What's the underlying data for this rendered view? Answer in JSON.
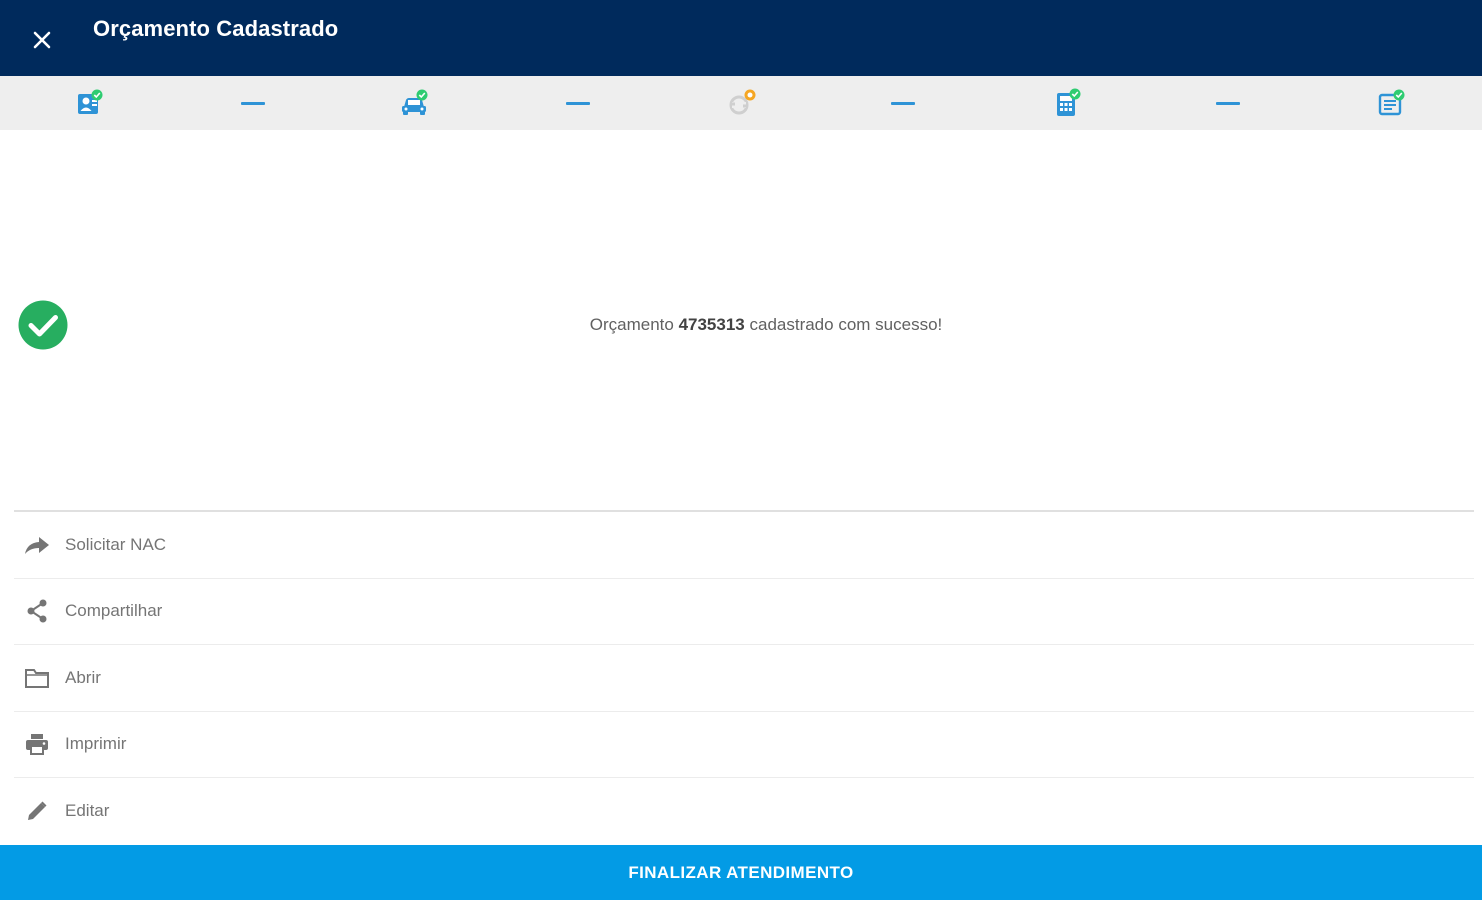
{
  "appbar": {
    "title": "Orçamento Cadastrado",
    "close_icon": "close-icon"
  },
  "stepper": {
    "steps": [
      {
        "icon": "client-check-icon",
        "status": "done"
      },
      {
        "icon": "car-check-icon",
        "status": "done"
      },
      {
        "icon": "sync-alert-icon",
        "status": "pending"
      },
      {
        "icon": "calculator-check-icon",
        "status": "done"
      },
      {
        "icon": "document-check-icon",
        "status": "done"
      }
    ]
  },
  "success": {
    "prefix": "Orçamento",
    "number": "4735313",
    "suffix": "cadastrado com sucesso!"
  },
  "actions": [
    {
      "label": "Solicitar NAC",
      "icon": "forward-arrow-icon"
    },
    {
      "label": "Compartilhar",
      "icon": "share-icon"
    },
    {
      "label": "Abrir",
      "icon": "folder-icon"
    },
    {
      "label": "Imprimir",
      "icon": "print-icon"
    },
    {
      "label": "Editar",
      "icon": "pencil-icon"
    }
  ],
  "footer": {
    "button_label": "FINALIZAR ATENDIMENTO"
  },
  "colors": {
    "appbar": "#002a5c",
    "accent": "#039be5",
    "success": "#27ae60",
    "step_blue": "#2e93d6",
    "step_check": "#2ecc71",
    "step_warning": "#f5a623"
  }
}
